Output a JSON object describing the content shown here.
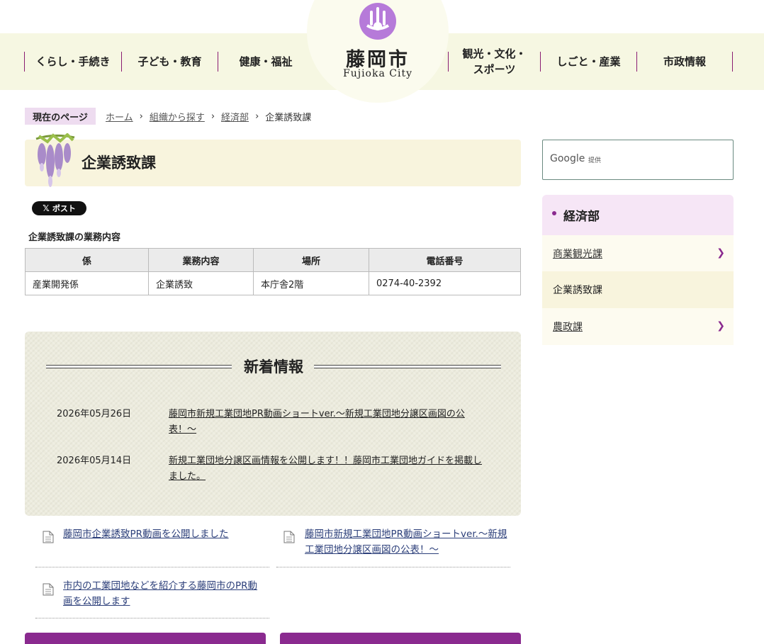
{
  "header": {
    "logo_title": "藤岡市",
    "logo_sub": "Fujioka City",
    "nav_left": [
      "くらし・手続き",
      "子ども・教育",
      "健康・福祉"
    ],
    "nav_right": [
      "観光・文化・\nスポーツ",
      "しごと・産業",
      "市政情報"
    ],
    "accent_color": "#8a1c72"
  },
  "breadcrumb": {
    "label": "現在のページ",
    "items": [
      "ホーム",
      "組織から探す",
      "経済部",
      "企業誘致課"
    ]
  },
  "page": {
    "title": "企業誘致課",
    "share_label": "ポスト",
    "section_label": "企業誘致課の業務内容"
  },
  "duties_table": {
    "headers": [
      "係",
      "業務内容",
      "場所",
      "電話番号"
    ],
    "rows": [
      [
        "産業開発係",
        "企業誘致",
        "本庁舎2階",
        "0274-40-2392"
      ]
    ]
  },
  "news": {
    "heading": "新着情報",
    "items": [
      {
        "date": "2026年05月26日",
        "title": "藤岡市新規工業団地PR動画ショートver.〜新規工業団地分譲区画図の公表！〜"
      },
      {
        "date": "2026年05月14日",
        "title": "新規工業団地分譲区画情報を公開します！！藤岡市工業団地ガイドを掲載しました。"
      }
    ]
  },
  "links": [
    "藤岡市企業誘致PR動画を公開しました",
    "藤岡市新規工業団地PR動画ショートver.〜新規工業団地分譲区画図の公表！〜",
    "市内の工業団地などを紹介する藤岡市のPR動画を公開します"
  ],
  "sidebar": {
    "search_brand": "Google",
    "search_brand_sub": "提供",
    "section_title": "経済部",
    "items": [
      {
        "label": "商業観光課",
        "link": true
      },
      {
        "label": "企業誘致課",
        "link": false
      },
      {
        "label": "農政課",
        "link": true
      }
    ]
  }
}
